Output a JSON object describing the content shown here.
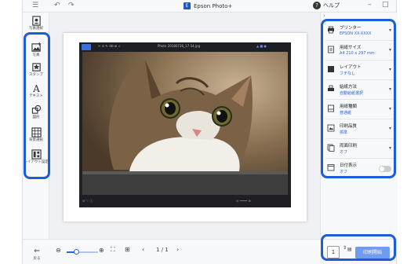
{
  "app": {
    "title": "Epson Photo+",
    "help_label": "ヘルプ"
  },
  "left_tools": [
    {
      "label": "写真選択"
    },
    {
      "label": "写真"
    },
    {
      "label": "スタンプ"
    },
    {
      "label": "テキスト"
    },
    {
      "label": "図形"
    },
    {
      "label": "背景選択"
    },
    {
      "label": "レイアウト設定"
    }
  ],
  "back_label": "戻る",
  "photo_window": {
    "title": "Photo 20180726_17-34.jpg"
  },
  "settings": [
    {
      "name": "プリンター",
      "value": "EPSON XX-XXXX"
    },
    {
      "name": "用紙サイズ",
      "value": "A4 210 x 297 mm"
    },
    {
      "name": "レイアウト",
      "value": "フチなし"
    },
    {
      "name": "給紙方法",
      "value": "自動給紙選択"
    },
    {
      "name": "用紙種類",
      "value": "普通紙"
    },
    {
      "name": "印刷品質",
      "value": "標準"
    },
    {
      "name": "両面印刷",
      "value": "オフ"
    },
    {
      "name": "日付表示",
      "value": "オフ",
      "toggle_on": false
    }
  ],
  "pager": {
    "current": "1",
    "total": "1",
    "separator": "/"
  },
  "zoom": {
    "level_fraction": 0.3
  },
  "copies": "1",
  "print_button": "印刷開始",
  "colors": {
    "accent": "#1e5cd8",
    "print_button": "#6f9bf0"
  }
}
